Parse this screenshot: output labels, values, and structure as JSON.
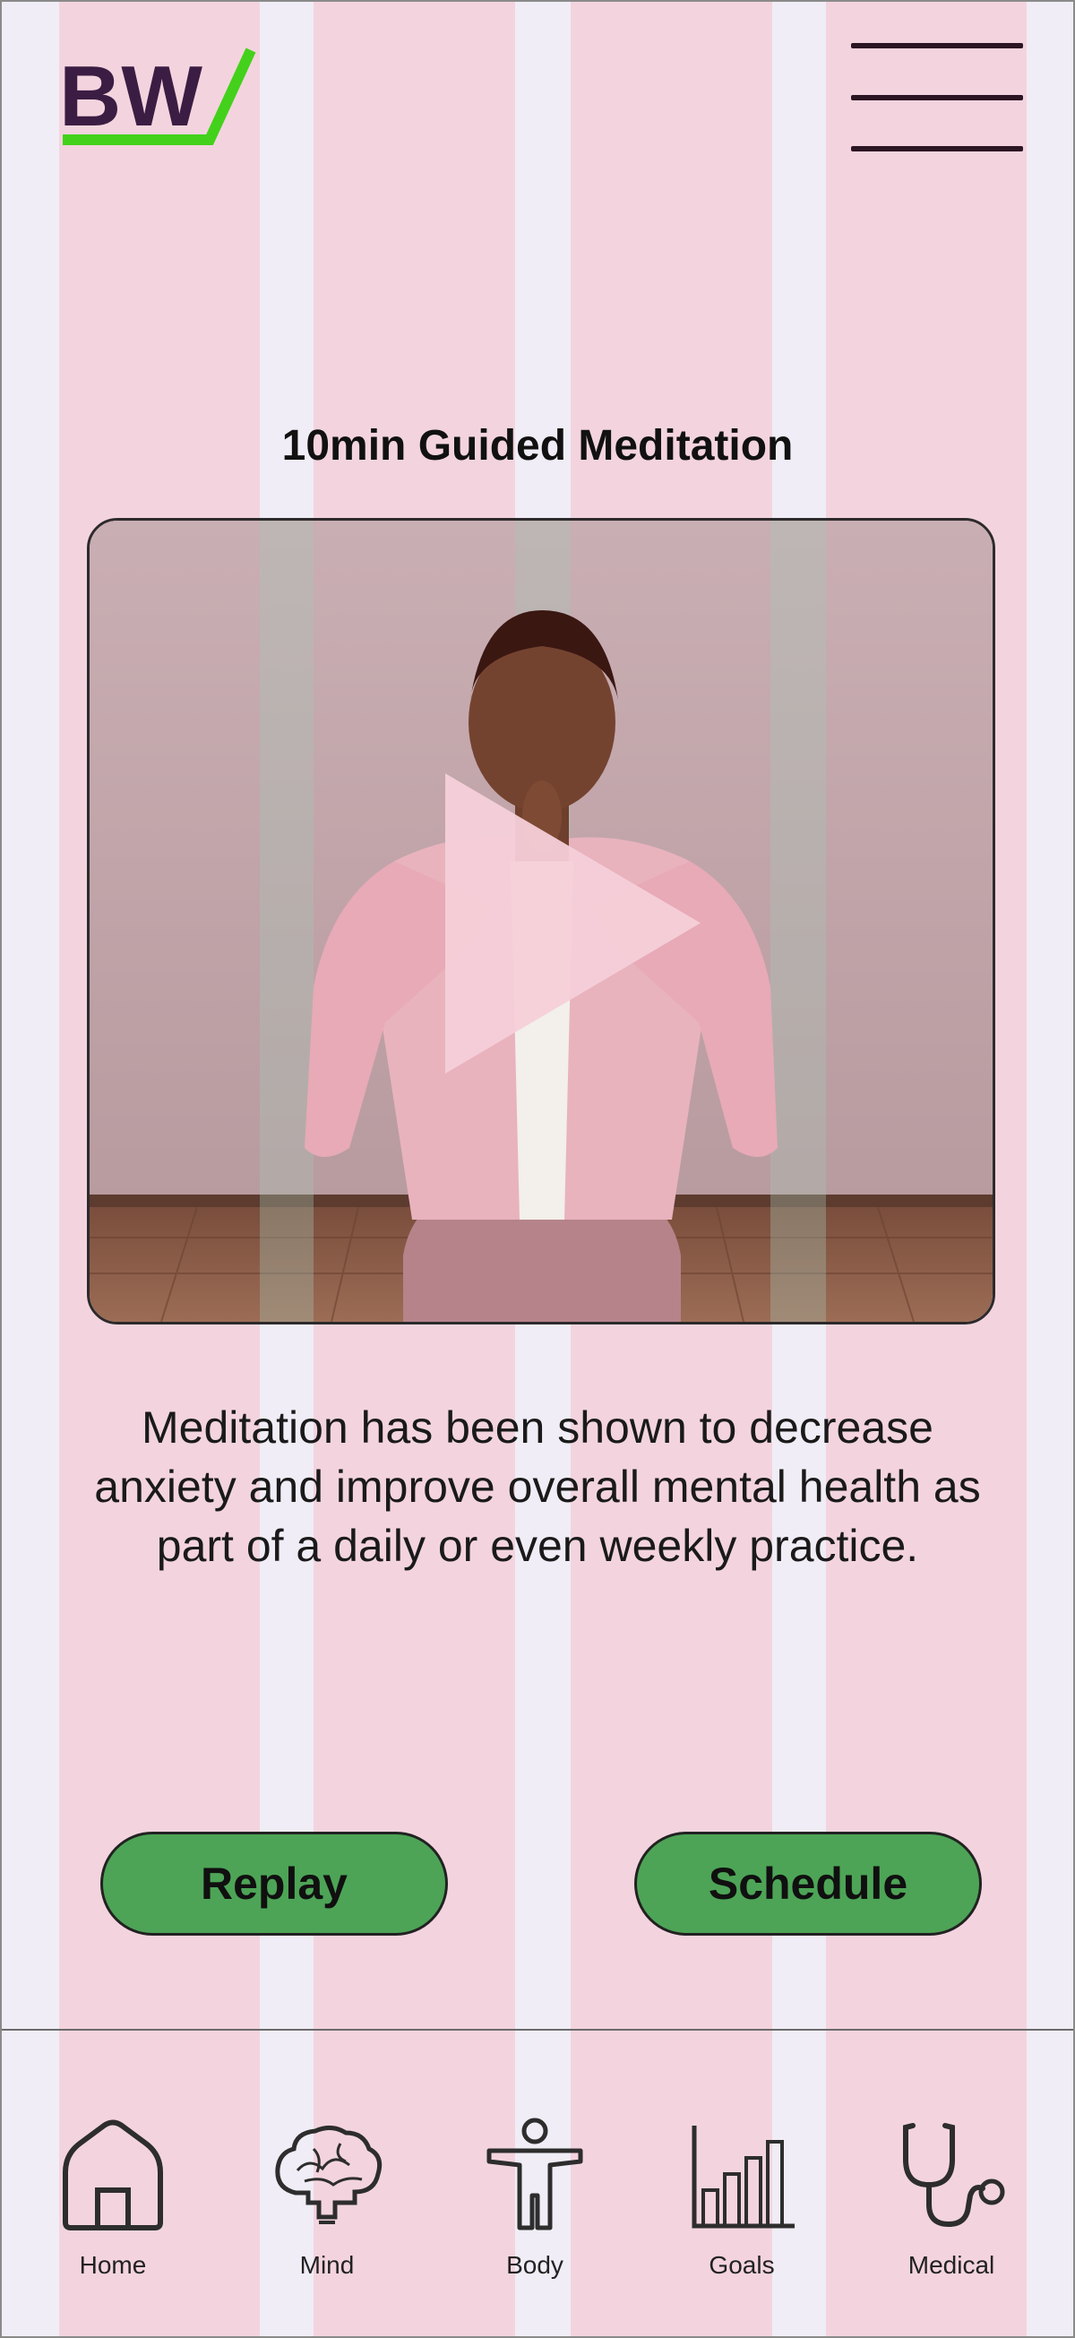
{
  "header": {
    "logo_text": "BW",
    "menu_icon": "hamburger-menu-icon"
  },
  "main": {
    "title": "10min Guided Meditation",
    "video_icon": "play-icon",
    "description": "Meditation has been shown to decrease anxiety and improve overall mental health as part of a daily or even weekly practice.",
    "buttons": {
      "replay": "Replay",
      "schedule": "Schedule"
    }
  },
  "nav": {
    "items": [
      {
        "label": "Home",
        "icon": "home-icon"
      },
      {
        "label": "Mind",
        "icon": "brain-icon"
      },
      {
        "label": "Body",
        "icon": "person-icon"
      },
      {
        "label": "Goals",
        "icon": "bar-chart-icon"
      },
      {
        "label": "Medical",
        "icon": "stethoscope-icon"
      }
    ]
  },
  "colors": {
    "background": "#f0edf6",
    "column_overlay": "#f3d4de",
    "logo_text": "#3b1d44",
    "logo_accent": "#43d11b",
    "button": "#4da456"
  }
}
